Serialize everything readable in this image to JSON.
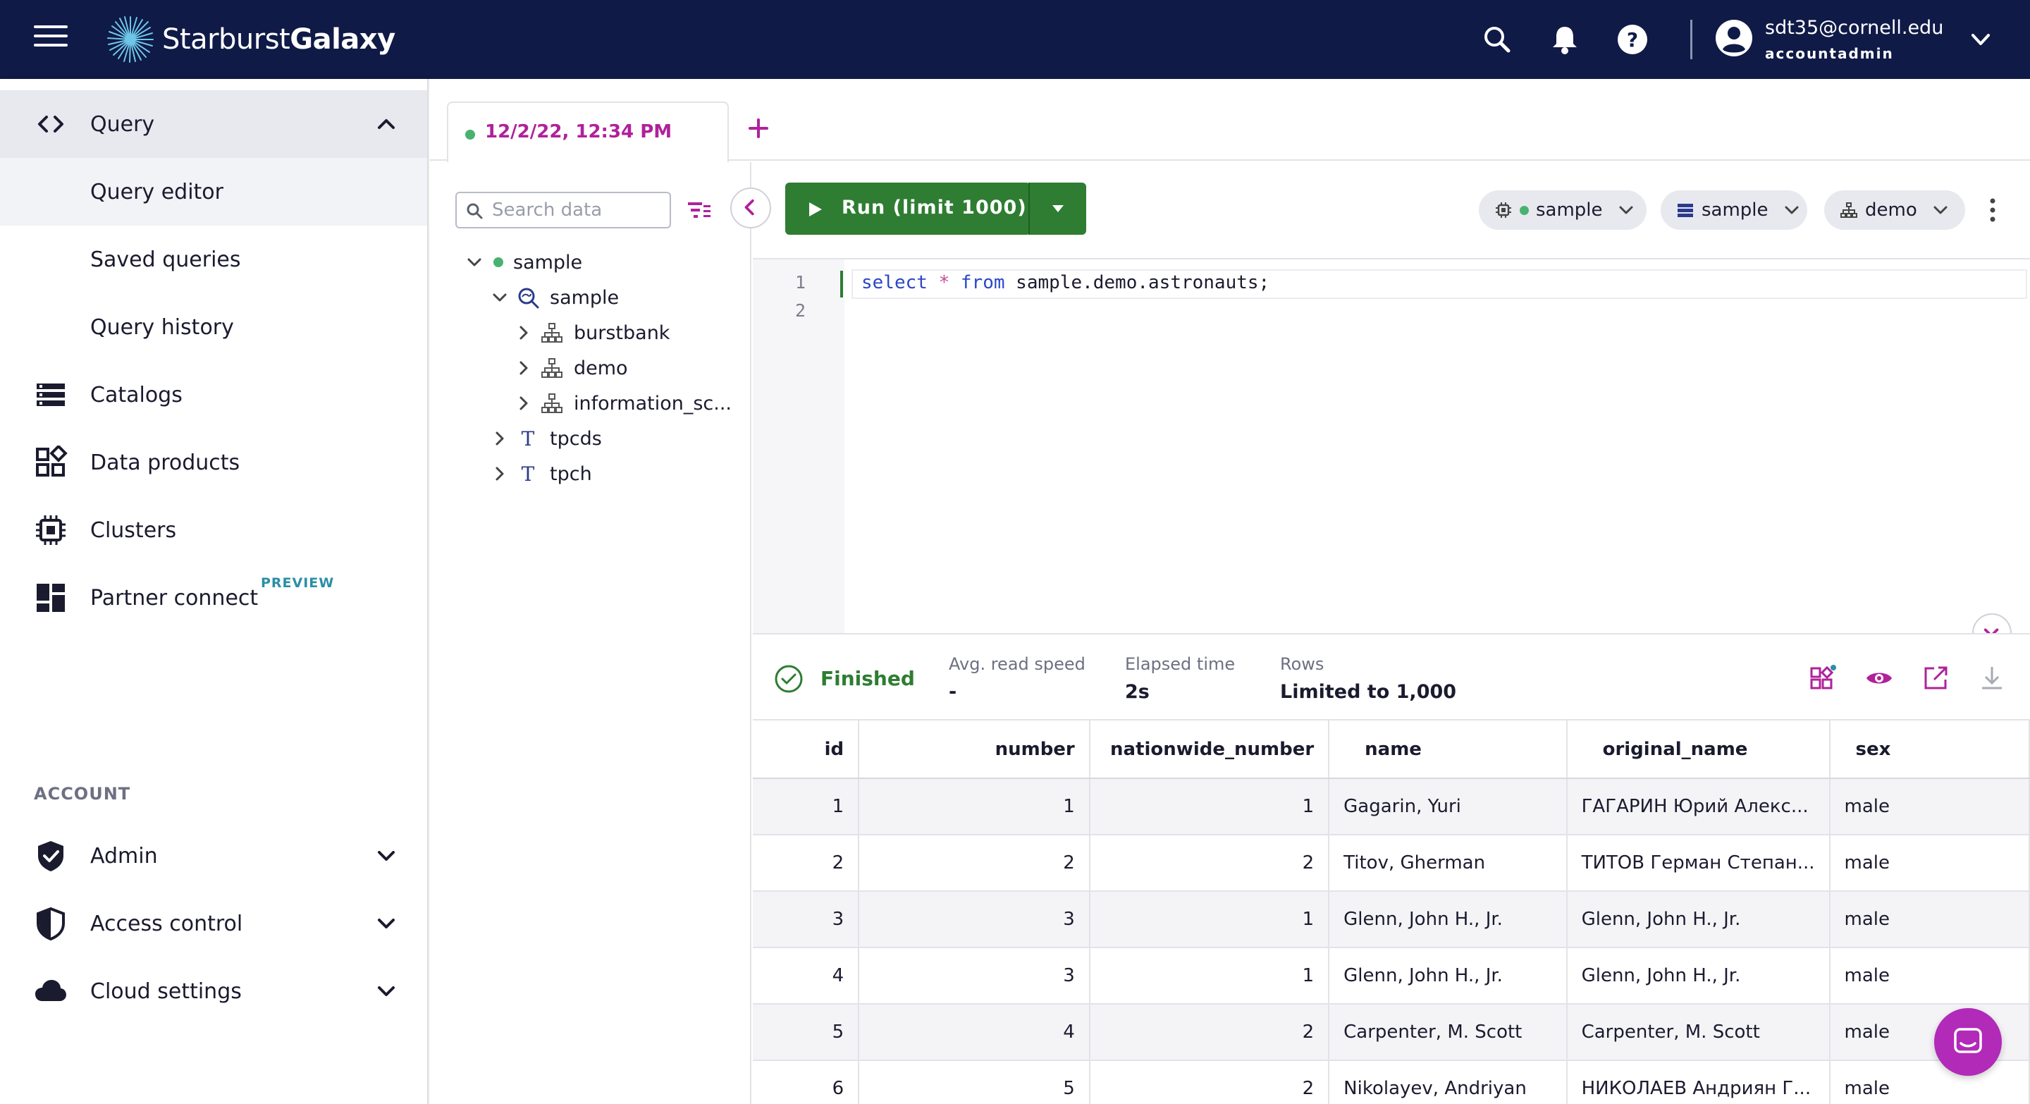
{
  "header": {
    "logo_text_light": "Starburst",
    "logo_text_bold": "Galaxy",
    "user_email": "sdt35@cornell.edu",
    "user_role": "accountadmin"
  },
  "sidebar": {
    "items": [
      {
        "label": "Query",
        "icon": "code-icon",
        "expanded": true
      },
      {
        "label": "Query editor"
      },
      {
        "label": "Saved queries"
      },
      {
        "label": "Query history"
      },
      {
        "label": "Catalogs",
        "icon": "catalog-icon"
      },
      {
        "label": "Data products",
        "icon": "data-products-icon"
      },
      {
        "label": "Clusters",
        "icon": "cluster-icon"
      },
      {
        "label": "Partner connect",
        "icon": "partner-icon",
        "badge": "PREVIEW"
      }
    ],
    "section_label": "ACCOUNT",
    "account_items": [
      {
        "label": "Admin",
        "icon": "shield-check-icon"
      },
      {
        "label": "Access control",
        "icon": "shield-half-icon"
      },
      {
        "label": "Cloud settings",
        "icon": "cloud-icon"
      }
    ]
  },
  "tabs": {
    "active_label": "12/2/22, 12:34 PM"
  },
  "tree": {
    "search_placeholder": "Search data",
    "nodes": [
      {
        "label": "sample"
      },
      {
        "label": "sample"
      },
      {
        "label": "burstbank"
      },
      {
        "label": "demo"
      },
      {
        "label": "information_sc..."
      },
      {
        "label": "tpcds"
      },
      {
        "label": "tpch"
      }
    ]
  },
  "toolbar": {
    "run_label": "Run (limit 1000)",
    "cluster": "sample",
    "catalog": "sample",
    "schema": "demo"
  },
  "editor": {
    "line_numbers": [
      "1",
      "2"
    ],
    "code": {
      "kw1": "select",
      "op": "*",
      "kw2": "from",
      "rest": "sample.demo.astronauts;"
    }
  },
  "results": {
    "status": "Finished",
    "stats": [
      {
        "label": "Avg. read speed",
        "value": "-"
      },
      {
        "label": "Elapsed time",
        "value": "2s"
      },
      {
        "label": "Rows",
        "value": "Limited to 1,000"
      }
    ],
    "columns": [
      "id",
      "number",
      "nationwide_number",
      "name",
      "original_name",
      "sex"
    ],
    "rows": [
      [
        "1",
        "1",
        "1",
        "Gagarin, Yuri",
        "ГАГАРИН Юрий Алекс...",
        "male"
      ],
      [
        "2",
        "2",
        "2",
        "Titov, Gherman",
        "ТИТОВ Герман Степан...",
        "male"
      ],
      [
        "3",
        "3",
        "1",
        "Glenn, John H., Jr.",
        "Glenn, John H., Jr.",
        "male"
      ],
      [
        "4",
        "3",
        "1",
        "Glenn, John H., Jr.",
        "Glenn, John H., Jr.",
        "male"
      ],
      [
        "5",
        "4",
        "2",
        "Carpenter, M. Scott",
        "Carpenter, M. Scott",
        "male"
      ],
      [
        "6",
        "5",
        "2",
        "Nikolayev, Andriyan",
        "НИКОЛАЕВ Андриян Г...",
        "male"
      ]
    ]
  },
  "colors": {
    "header_bg": "#0f1a47",
    "accent": "#b0219b",
    "run_green": "#2e7d32",
    "status_green": "#49b26f"
  }
}
